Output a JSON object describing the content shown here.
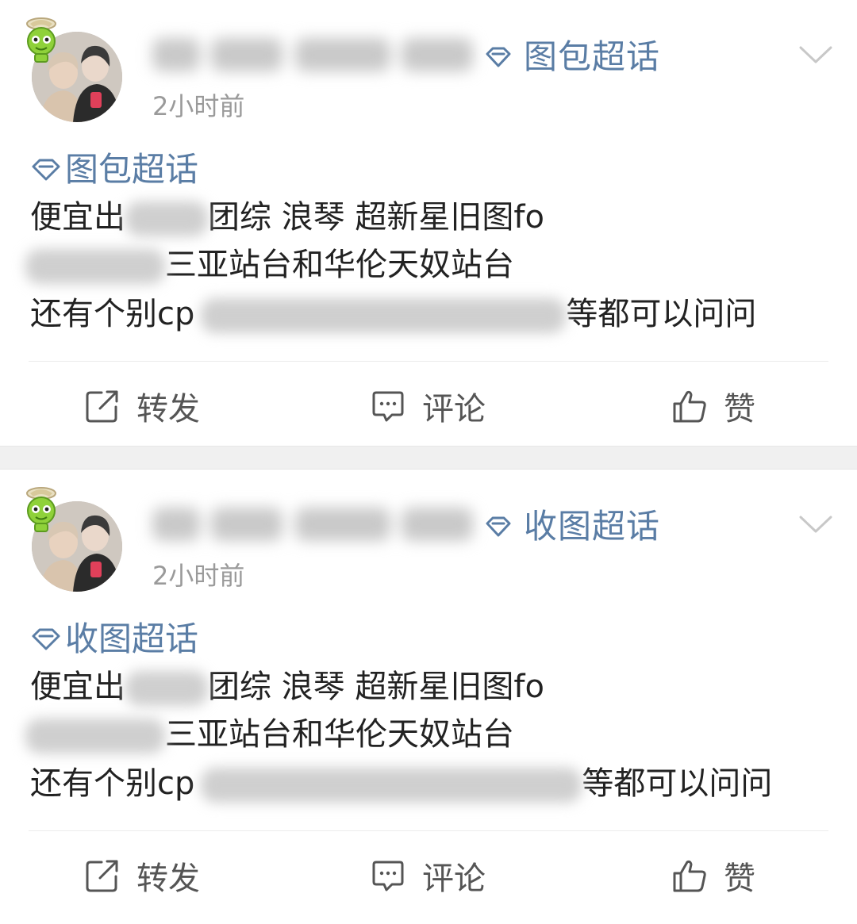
{
  "posts": [
    {
      "topic_label": "图包超话",
      "time": "2小时前",
      "tag": "图包超话",
      "line1_a": "便宜出",
      "line1_b": "团综 浪琴 超新星旧图fo",
      "line2": "三亚站台和华伦天奴站台",
      "line3_a": "还有个别cp",
      "line3_b": "等都可以问问"
    },
    {
      "topic_label": "收图超话",
      "time": "2小时前",
      "tag": "收图超话",
      "line1_a": "便宜出",
      "line1_b": "团综 浪琴 超新星旧图fo",
      "line2": "三亚站台和华伦天奴站台",
      "line3_a": "还有个别cp",
      "line3_b": "等都可以问问"
    }
  ],
  "actions": {
    "repost": "转发",
    "comment": "评论",
    "like": "赞"
  },
  "icons": {
    "topic": "diamond-icon",
    "menu": "chevron-down-icon",
    "repost": "repost-icon",
    "comment": "comment-icon",
    "like": "thumbs-up-icon",
    "badge": "green-alien-badge-icon"
  },
  "colors": {
    "topic": "#5a7da5",
    "text": "#222222",
    "meta": "#9a9a9a",
    "action": "#555555",
    "separator": "#f0f0f0"
  }
}
